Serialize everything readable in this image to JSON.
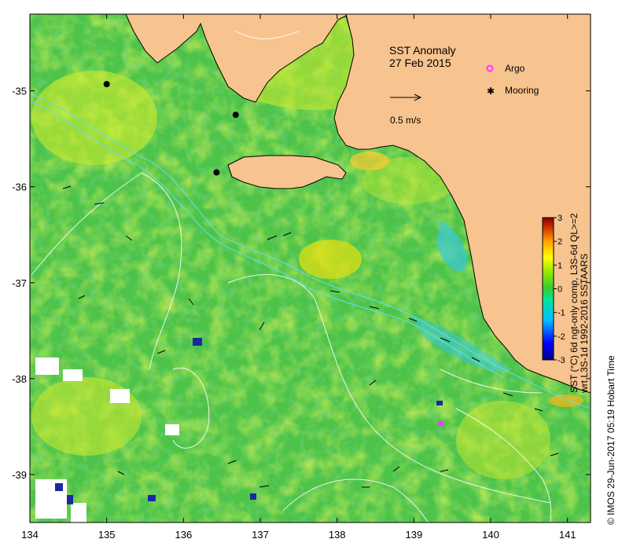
{
  "title": {
    "line1": "SST Anomaly",
    "line2": "27 Feb 2015"
  },
  "legend": {
    "argo": "Argo",
    "mooring": "Mooring",
    "scale_label": "0.5 m/s",
    "argo_color": "#ff33ff",
    "mooring_color": "#000000"
  },
  "axes": {
    "x_ticks": [
      "134",
      "135",
      "136",
      "137",
      "138",
      "139",
      "140",
      "141"
    ],
    "y_ticks": [
      "-35",
      "-36",
      "-37",
      "-38",
      "-39"
    ],
    "x_range": [
      134,
      141.3
    ],
    "y_range": [
      -39.5,
      -34.2
    ]
  },
  "colorbar": {
    "label_line1": "SST (°C) 6d ngt-only comp, L3S-6d QL>=2",
    "label_line2": "wrt L3S-1d 1992-2016 SSTAARS",
    "ticks": [
      "3",
      "2",
      "1",
      "0",
      "-1",
      "-2",
      "-3"
    ],
    "min": -3,
    "max": 3,
    "colors": [
      "#00007f",
      "#0000ff",
      "#00bfff",
      "#00ff80",
      "#33cc33",
      "#99e600",
      "#ffff00",
      "#ff9900",
      "#cc3300",
      "#7f0000"
    ]
  },
  "credit": "© IMOS 29-Jun-2017 05:19 Hobart Time",
  "colors": {
    "land": "#f7c38e",
    "ocean_base": "#4ec34a",
    "contour": "#ffffff",
    "shelf_contour": "#5fe0e8"
  },
  "markers": {
    "moorings": [
      {
        "lon": 135.0,
        "lat": -34.93
      },
      {
        "lon": 136.68,
        "lat": -35.25
      },
      {
        "lon": 136.43,
        "lat": -35.85
      }
    ],
    "argo": [
      {
        "lon": 139.35,
        "lat": -38.47
      }
    ]
  }
}
